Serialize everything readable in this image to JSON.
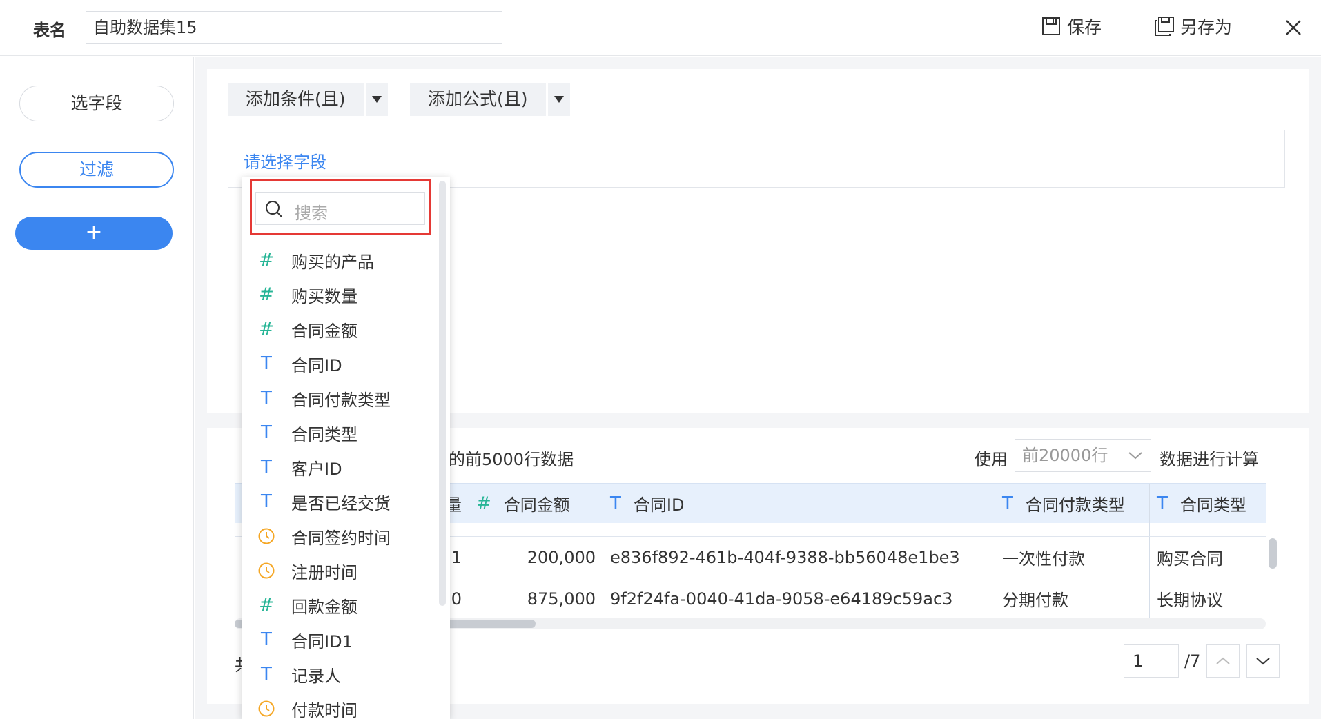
{
  "header": {
    "table_name_label": "表名",
    "table_name_value": "自助数据集15",
    "save_label": "保存",
    "save_as_label": "另存为"
  },
  "sidebar": {
    "steps": [
      {
        "label": "选字段"
      },
      {
        "label": "过滤"
      },
      {
        "label": "+"
      }
    ]
  },
  "toolbar": {
    "add_condition_label": "添加条件(且)",
    "add_formula_label": "添加公式(且)"
  },
  "condition": {
    "placeholder": "请选择字段"
  },
  "preview": {
    "info_text": "的前5000行数据",
    "use_label": "使用",
    "rows_option": "前20000行",
    "calc_label": "数据进行计算",
    "columns": [
      {
        "type": "text",
        "label": "量"
      },
      {
        "type": "number",
        "label": "合同金额"
      },
      {
        "type": "text",
        "label": "合同ID"
      },
      {
        "type": "text",
        "label": "合同付款类型"
      },
      {
        "type": "text",
        "label": "合同类型"
      }
    ],
    "rows": [
      [
        "1",
        "200,000",
        "e836f892-461b-404f-9388-bb56048e1be3",
        "一次性付款",
        "购买合同"
      ],
      [
        "0",
        "875,000",
        "9f2f24fa-0040-41da-9058-e64189c59ac3",
        "分期付款",
        "长期协议"
      ]
    ]
  },
  "pagination": {
    "total_text": "共",
    "current_page": "1",
    "total_pages": "/7"
  },
  "field_dropdown": {
    "search_placeholder": "搜索",
    "fields": [
      {
        "type": "number",
        "label": "购买的产品"
      },
      {
        "type": "number",
        "label": "购买数量"
      },
      {
        "type": "number",
        "label": "合同金额"
      },
      {
        "type": "text",
        "label": "合同ID"
      },
      {
        "type": "text",
        "label": "合同付款类型"
      },
      {
        "type": "text",
        "label": "合同类型"
      },
      {
        "type": "text",
        "label": "客户ID"
      },
      {
        "type": "text",
        "label": "是否已经交货"
      },
      {
        "type": "date",
        "label": "合同签约时间"
      },
      {
        "type": "date",
        "label": "注册时间"
      },
      {
        "type": "number",
        "label": "回款金额"
      },
      {
        "type": "text",
        "label": "合同ID1"
      },
      {
        "type": "text",
        "label": "记录人"
      },
      {
        "type": "date",
        "label": "付款时间"
      }
    ]
  },
  "colors": {
    "accent": "#3b86f0",
    "number_type": "#27b596",
    "date_type": "#f5a623",
    "highlight": "#e53935"
  }
}
